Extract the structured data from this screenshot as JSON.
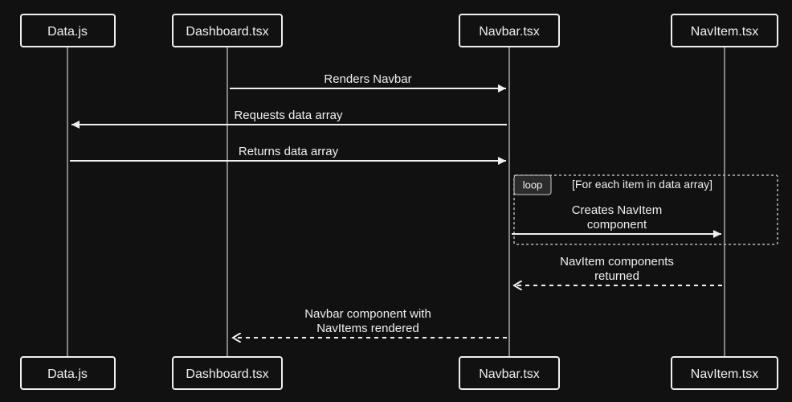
{
  "participants": [
    {
      "id": "data",
      "label": "Data.js"
    },
    {
      "id": "dashboard",
      "label": "Dashboard.tsx"
    },
    {
      "id": "navbar",
      "label": "Navbar.tsx"
    },
    {
      "id": "navitem",
      "label": "NavItem.tsx"
    }
  ],
  "messages": {
    "m1": "Renders Navbar",
    "m2": "Requests data array",
    "m3": "Returns data array",
    "m4_line1": "Creates NavItem",
    "m4_line2": "component",
    "m5_line1": "NavItem components",
    "m5_line2": "returned",
    "m6_line1": "Navbar component with",
    "m6_line2": "NavItems rendered"
  },
  "loop": {
    "label": "loop",
    "condition": "[For each item in data array]"
  }
}
